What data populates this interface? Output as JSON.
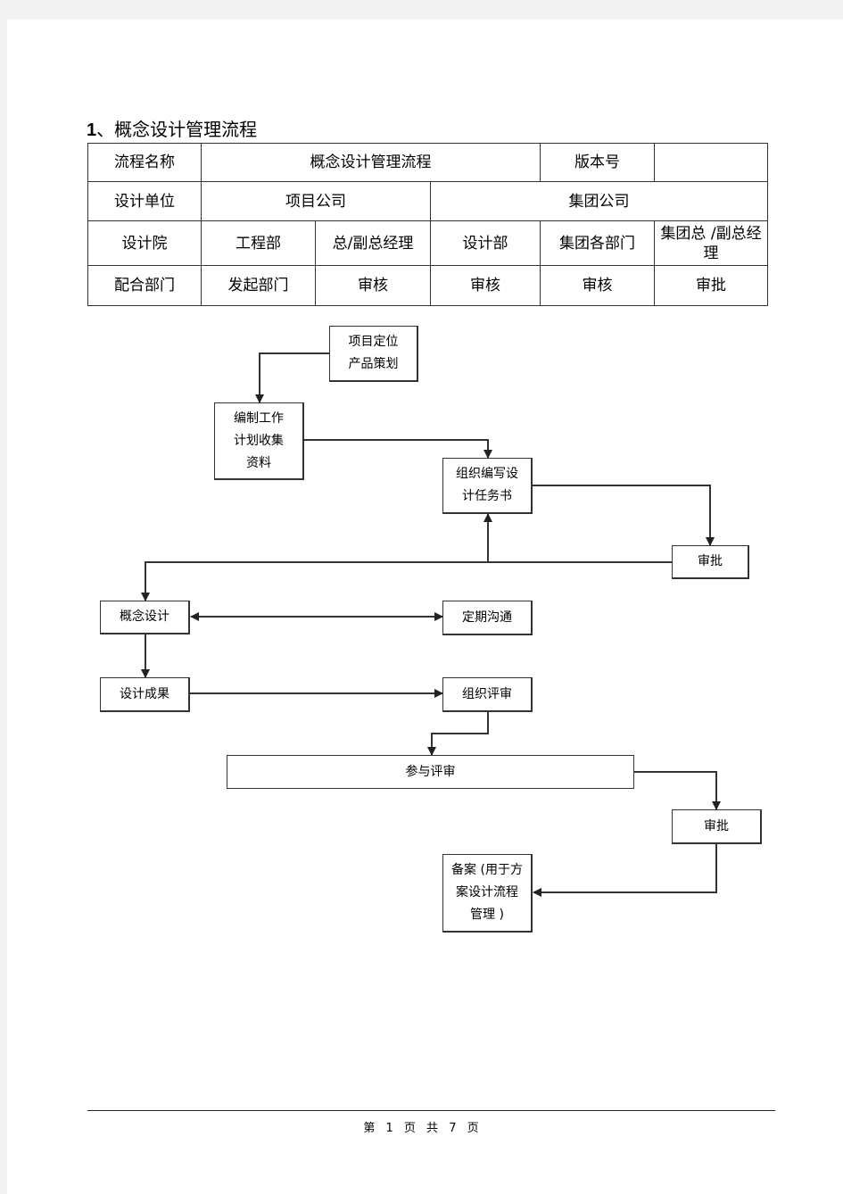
{
  "document": {
    "heading_number": "1",
    "heading_text": "、概念设计管理流程"
  },
  "info_table": {
    "row1": {
      "process_name_label": "流程名称",
      "process_name_value": "概念设计管理流程",
      "version_label": "版本号",
      "version_value": ""
    },
    "row2": {
      "design_unit_label": "设计单位",
      "project_company": "项目公司",
      "group_company": "集团公司"
    },
    "row3": [
      "设计院",
      "工程部",
      "总/副总经理",
      "设计部",
      "集团各部门",
      "集团总 /副总经理"
    ],
    "row4": [
      "配合部门",
      "发起部门",
      "审核",
      "审核",
      "审核",
      "审批"
    ]
  },
  "flowchart": {
    "nodes": {
      "positioning": [
        "项目定位",
        "产品策划"
      ],
      "work_plan": [
        "编制工作",
        "计划收集",
        "资料"
      ],
      "task_book": [
        "组织编写设",
        "计任务书"
      ],
      "approval_1": [
        "审批"
      ],
      "concept_design": [
        "概念设计"
      ],
      "regular_communication": [
        "定期沟通"
      ],
      "design_result": [
        "设计成果"
      ],
      "organize_review": [
        "组织评审"
      ],
      "participate_review": [
        "参与评审"
      ],
      "approval_2": [
        "审批"
      ],
      "archive": [
        "备案 (用于方",
        "案设计流程",
        "管理 )"
      ]
    }
  },
  "footer": {
    "page_text": "第 1 页 共 7 页"
  }
}
